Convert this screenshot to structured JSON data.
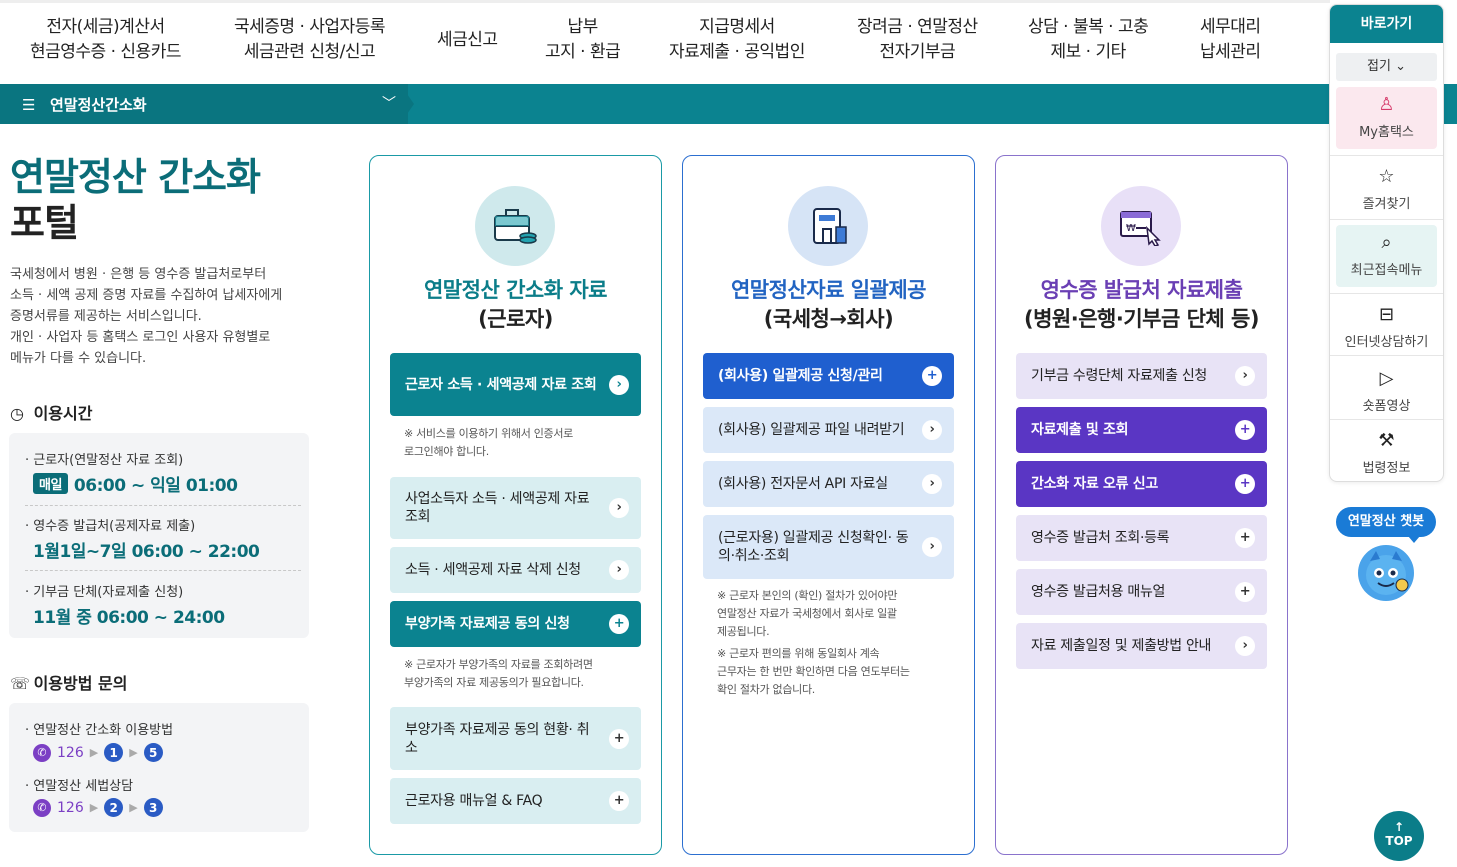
{
  "topnav": [
    {
      "l1": "전자(세금)계산서",
      "l2": "현금영수증 · 신용카드"
    },
    {
      "l1": "국세증명 · 사업자등록",
      "l2": "세금관련 신청/신고"
    },
    {
      "l1": "세금신고",
      "l2": ""
    },
    {
      "l1": "납부",
      "l2": "고지 · 환급"
    },
    {
      "l1": "지급명세서",
      "l2": "자료제출 · 공익법인"
    },
    {
      "l1": "장려금 · 연말정산",
      "l2": "전자기부금"
    },
    {
      "l1": "상담 · 불복 · 고충",
      "l2": "제보 · 기타"
    },
    {
      "l1": "세무대리",
      "l2": "납세관리"
    }
  ],
  "breadcrumb": {
    "menu": "연말정산간소화"
  },
  "intro": {
    "title1": "연말정산 간소화",
    "title2": "포털",
    "desc": [
      "국세청에서 병원 · 은행 등 영수증 발급처로부터",
      "소득 · 세액 공제 증명 자료를 수집하여 납세자에게",
      "증명서류를 제공하는 서비스입니다.",
      "개인 · 사업자 등 홈택스 로그인 사용자 유형별로",
      "메뉴가 다를 수 있습니다."
    ]
  },
  "hours": {
    "heading": "이용시간",
    "rows": [
      {
        "label": "근로자(연말정산 자료 조회)",
        "badge": "매일",
        "value": "06:00 ~ 익일 01:00"
      },
      {
        "label": "영수증 발급처(공제자료 제출)",
        "badge": "",
        "value": "1월1일~7일 06:00 ~ 22:00"
      },
      {
        "label": "기부금 단체(자료제출 신청)",
        "badge": "",
        "value": "11월 중 06:00 ~ 24:00"
      }
    ]
  },
  "inquiry": {
    "heading": "이용방법 문의",
    "rows": [
      {
        "label": "연말정산 간소화 이용방법",
        "phone": "126",
        "n1": "1",
        "n2": "5"
      },
      {
        "label": "연말정산 세법상담",
        "phone": "126",
        "n1": "2",
        "n2": "3"
      }
    ]
  },
  "card1": {
    "title1": "연말정산 간소화 자료",
    "title2": "(근로자)",
    "btn1": "근로자 소득 · 세액공제 자료 조회",
    "note1": [
      "※ 서비스를 이용하기 위해서 인증서로",
      "로그인해야 합니다."
    ],
    "btn2": "사업소득자 소득 · 세액공제 자료 조회",
    "btn3": "소득 · 세액공제 자료 삭제 신청",
    "btn4": "부양가족 자료제공 동의 신청",
    "note2": [
      "※ 근로자가 부양가족의 자료를 조회하려면",
      "부양가족의 자료 제공동의가 필요합니다."
    ],
    "btn5": "부양가족 자료제공 동의 현황· 취소",
    "btn6": "근로자용 매뉴얼 & FAQ"
  },
  "card2": {
    "title1": "연말정산자료 일괄제공",
    "title2": "(국세청→회사)",
    "btn1": "(회사용) 일괄제공 신청/관리",
    "btn2": "(회사용) 일괄제공 파일 내려받기",
    "btn3": "(회사용) 전자문서 API 자료실",
    "btn4": "(근로자용) 일괄제공 신청확인· 동의·취소·조회",
    "note1": [
      "※ 근로자 본인의 (확인) 절차가 있어야만",
      "연말정산 자료가 국세청에서 회사로 일괄",
      "제공됩니다."
    ],
    "note2": [
      "※ 근로자 편의를 위해 동일회사 계속",
      "근무자는 한 번만 확인하면 다음 연도부터는",
      "확인 절차가 없습니다."
    ]
  },
  "card3": {
    "title1": "영수증 발급처 자료제출",
    "title2": "(병원·은행·기부금 단체 등)",
    "btn1": "기부금 수령단체 자료제출 신청",
    "btn2": "자료제출 및 조회",
    "btn3": "간소화 자료 오류 신고",
    "btn4": "영수증 발급처 조회·등록",
    "btn5": "영수증 발급처용 매뉴얼",
    "btn6": "자료 제출일정 및 제출방법 안내"
  },
  "quick": {
    "head": "바로가기",
    "fold": "접기",
    "items": [
      "My홈택스",
      "즐겨찾기",
      "최근접속메뉴",
      "인터넷상담하기",
      "숏폼영상",
      "법령정보"
    ]
  },
  "chatbot": "연말정산 챗봇",
  "top_btn": "TOP"
}
